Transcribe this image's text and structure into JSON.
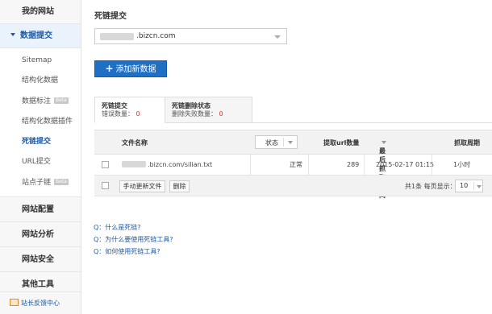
{
  "sidebar": {
    "top": "我的网站",
    "active_group": "数据提交",
    "items": [
      {
        "label": "Sitemap",
        "beta": ""
      },
      {
        "label": "结构化数据",
        "beta": ""
      },
      {
        "label": "数据标注",
        "beta": "Beta"
      },
      {
        "label": "结构化数据插件",
        "beta": ""
      },
      {
        "label": "死链提交",
        "beta": ""
      },
      {
        "label": "URL提交",
        "beta": ""
      },
      {
        "label": "站点子链",
        "beta": "Beta"
      }
    ],
    "groups": [
      "网站配置",
      "网站分析",
      "网站安全",
      "其他工具"
    ],
    "feedback": "站长反馈中心"
  },
  "main": {
    "title": "死链提交",
    "site_value": ".bizcn.com",
    "add_button": "添加新数据"
  },
  "tabs": [
    {
      "name": "死链提交",
      "sub_label": "错误数量：",
      "count": "0"
    },
    {
      "name": "死链删除状态",
      "sub_label": "删除失败数量：",
      "count": "0"
    }
  ],
  "table": {
    "headers": {
      "file": "文件名称",
      "status": "状态",
      "count": "提取url数量",
      "last_time": "最后抓取时间",
      "crawl_cycle": "抓取周期"
    },
    "rows": [
      {
        "file": ".bizcn.com/silian.txt",
        "status": "正常",
        "count": "289",
        "last_time": "2015-02-17 01:15",
        "crawl_cycle": "1小时"
      }
    ],
    "footer": {
      "update_button": "手动更新文件",
      "delete_button": "删除",
      "summary": "共1条 每页显示：",
      "page_size": "10"
    }
  },
  "faq": [
    "Q：什么是死链?",
    "Q：为什么要使用死链工具?",
    "Q：如何使用死链工具?"
  ],
  "colors": {
    "accent": "#1f6fc5",
    "link": "#1a5aa8",
    "error_count": "#dd3333"
  }
}
